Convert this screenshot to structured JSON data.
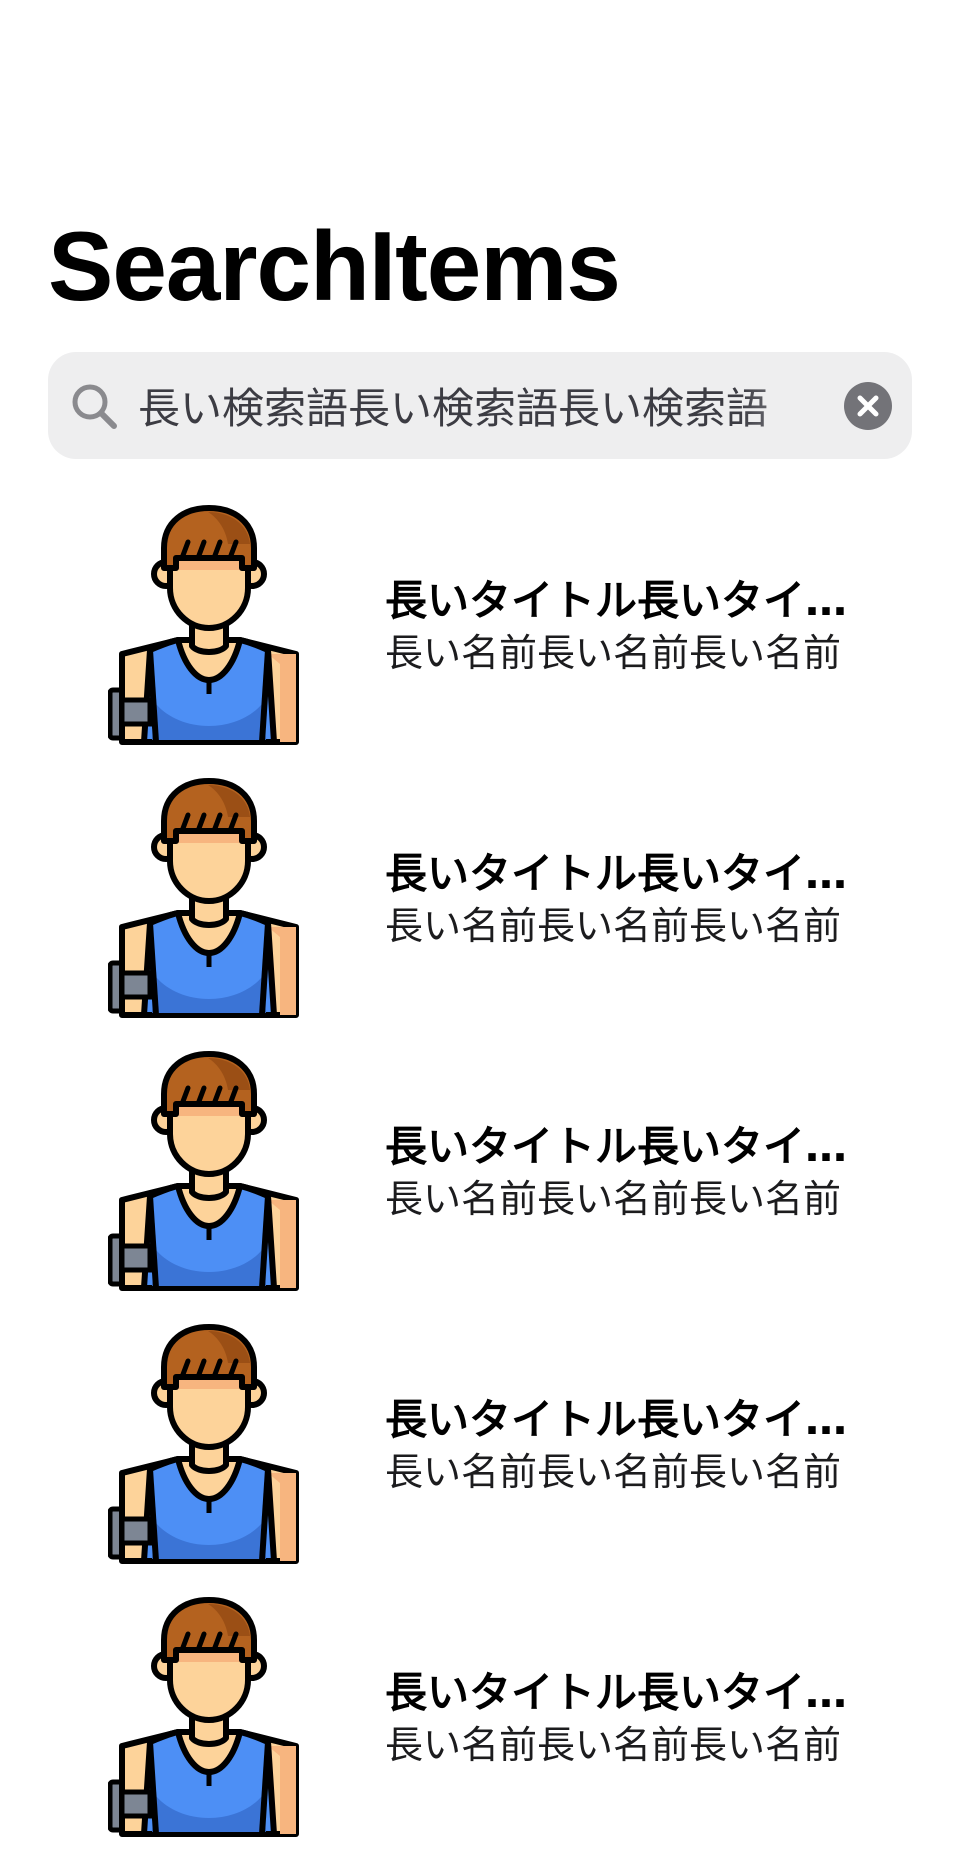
{
  "page": {
    "title": "SearchItems"
  },
  "search": {
    "value": "長い検索語長い検索語長い検索語",
    "placeholder": "",
    "search_icon": "magnifying-glass-icon",
    "clear_icon": "xmark-circle-icon"
  },
  "results": [
    {
      "title": "長いタイトル長いタイトル",
      "subtitle": "長い名前長い名前長い名前",
      "avatar_icon": "athlete-avatar-icon"
    },
    {
      "title": "長いタイトル長いタイトル",
      "subtitle": "長い名前長い名前長い名前",
      "avatar_icon": "athlete-avatar-icon"
    },
    {
      "title": "長いタイトル長いタイトル",
      "subtitle": "長い名前長い名前長い名前",
      "avatar_icon": "athlete-avatar-icon"
    },
    {
      "title": "長いタイトル長いタイトル",
      "subtitle": "長い名前長い名前長い名前",
      "avatar_icon": "athlete-avatar-icon"
    },
    {
      "title": "長いタイトル長いタイトル",
      "subtitle": "長い名前長い名前長い名前",
      "avatar_icon": "athlete-avatar-icon"
    }
  ],
  "colors": {
    "search_background": "#eeeeef",
    "clear_button": "#737378",
    "avatar_hair": "#b4621f",
    "avatar_skin": "#fdd39a",
    "avatar_shirt": "#4d8ff5",
    "outline": "#000000"
  }
}
